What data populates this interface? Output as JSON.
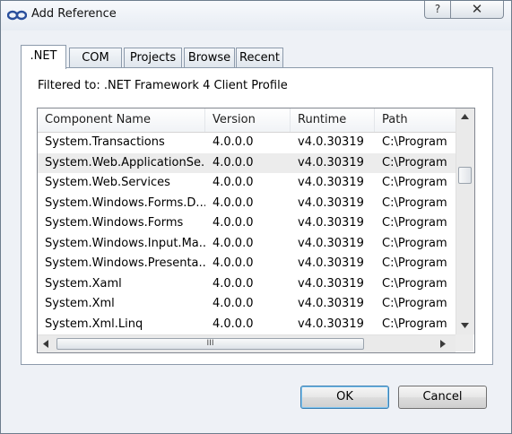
{
  "window": {
    "title": "Add Reference",
    "help_glyph": "?",
    "close_glyph": "✕",
    "icon": "add-reference-link-icon"
  },
  "tabs": [
    ".NET",
    "COM",
    "Projects",
    "Browse",
    "Recent"
  ],
  "active_tab": ".NET",
  "filter_label": "Filtered to: .NET Framework 4 Client Profile",
  "columns": [
    "Component Name",
    "Version",
    "Runtime",
    "Path"
  ],
  "rows": [
    [
      "System.Transactions",
      "4.0.0.0",
      "v4.0.30319",
      "C:\\Program"
    ],
    [
      "System.Web.ApplicationSe...",
      "4.0.0.0",
      "v4.0.30319",
      "C:\\Program"
    ],
    [
      "System.Web.Services",
      "4.0.0.0",
      "v4.0.30319",
      "C:\\Program"
    ],
    [
      "System.Windows.Forms.D...",
      "4.0.0.0",
      "v4.0.30319",
      "C:\\Program"
    ],
    [
      "System.Windows.Forms",
      "4.0.0.0",
      "v4.0.30319",
      "C:\\Program"
    ],
    [
      "System.Windows.Input.Ma...",
      "4.0.0.0",
      "v4.0.30319",
      "C:\\Program"
    ],
    [
      "System.Windows.Presenta...",
      "4.0.0.0",
      "v4.0.30319",
      "C:\\Program"
    ],
    [
      "System.Xaml",
      "4.0.0.0",
      "v4.0.30319",
      "C:\\Program"
    ],
    [
      "System.Xml",
      "4.0.0.0",
      "v4.0.30319",
      "C:\\Program"
    ],
    [
      "System.Xml.Linq",
      "4.0.0.0",
      "v4.0.30319",
      "C:\\Program"
    ]
  ],
  "selected_row": 1,
  "scroll_thumb_grip": "III",
  "buttons": {
    "ok": "OK",
    "cancel": "Cancel"
  },
  "colors": {
    "selection": "#ececec",
    "accent_border": "#3c7fb1"
  }
}
